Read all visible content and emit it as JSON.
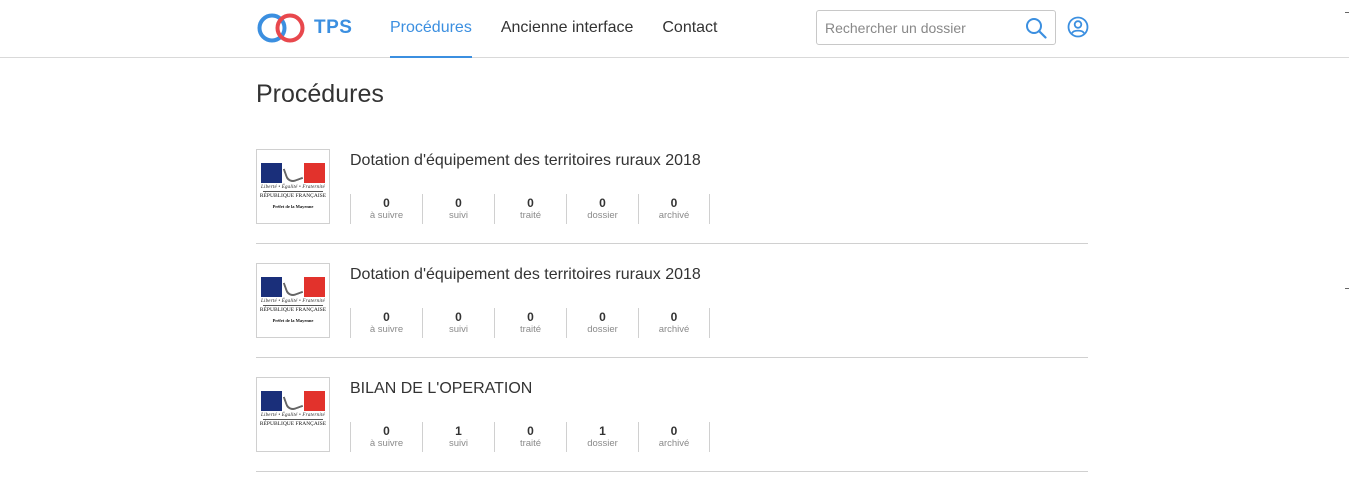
{
  "brand": {
    "name": "TPS",
    "color": "#3b8fe0",
    "accent_red": "#e8484d"
  },
  "nav": {
    "items": [
      {
        "label": "Procédures",
        "active": true
      },
      {
        "label": "Ancienne interface",
        "active": false
      },
      {
        "label": "Contact",
        "active": false
      }
    ]
  },
  "search": {
    "placeholder": "Rechercher un dossier",
    "value": "",
    "icon": "search-icon"
  },
  "user": {
    "icon": "user-circle-icon"
  },
  "page": {
    "title": "Procédures"
  },
  "logo_text": {
    "motto": "Liberté • Égalité • Fraternité",
    "republique": "RÉPUBLIQUE FRANÇAISE",
    "prefet": "Préfet de la Mayenne"
  },
  "procedures": [
    {
      "title": "Dotation d'équipement des territoires ruraux 2018",
      "show_prefet": true,
      "stats": [
        {
          "value": "0",
          "label": "à suivre"
        },
        {
          "value": "0",
          "label": "suivi"
        },
        {
          "value": "0",
          "label": "traité"
        },
        {
          "value": "0",
          "label": "dossier"
        },
        {
          "value": "0",
          "label": "archivé"
        }
      ]
    },
    {
      "title": "Dotation d'équipement des territoires ruraux 2018",
      "show_prefet": true,
      "stats": [
        {
          "value": "0",
          "label": "à suivre"
        },
        {
          "value": "0",
          "label": "suivi"
        },
        {
          "value": "0",
          "label": "traité"
        },
        {
          "value": "0",
          "label": "dossier"
        },
        {
          "value": "0",
          "label": "archivé"
        }
      ]
    },
    {
      "title": "BILAN DE L'OPERATION",
      "show_prefet": false,
      "stats": [
        {
          "value": "0",
          "label": "à suivre"
        },
        {
          "value": "1",
          "label": "suivi"
        },
        {
          "value": "0",
          "label": "traité"
        },
        {
          "value": "1",
          "label": "dossier"
        },
        {
          "value": "0",
          "label": "archivé"
        }
      ]
    }
  ]
}
